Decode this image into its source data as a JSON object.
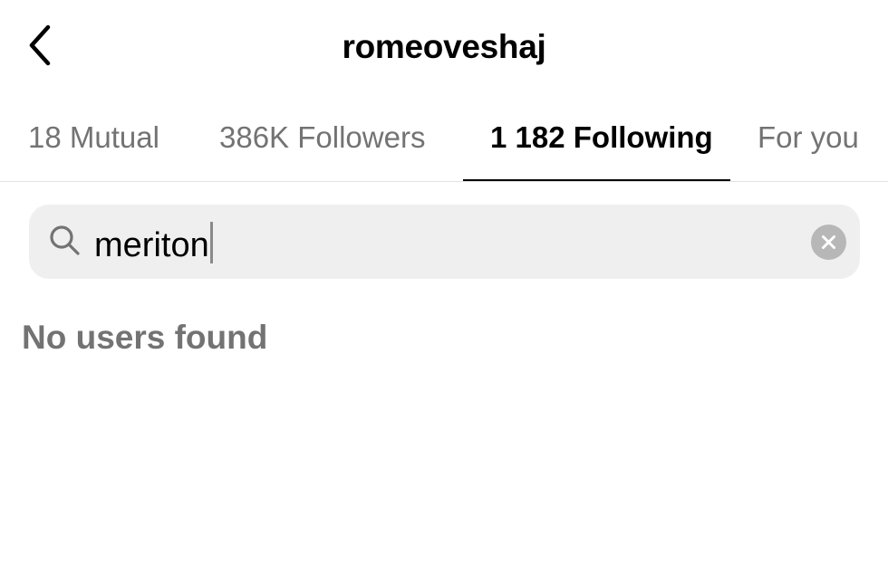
{
  "header": {
    "username": "romeoveshaj",
    "back_icon": "chevron-left-icon"
  },
  "tabs": [
    {
      "label": "18 Mutual",
      "active": false
    },
    {
      "label": "386K Followers",
      "active": false
    },
    {
      "label": "1 182 Following",
      "active": true
    },
    {
      "label": "For you",
      "active": false
    }
  ],
  "search": {
    "value": "meriton",
    "search_icon": "search-icon",
    "clear_icon": "clear-icon"
  },
  "results": {
    "empty_message": "No users found"
  },
  "colors": {
    "active_text": "#000000",
    "inactive_text": "#737373",
    "search_bg": "#efefef",
    "clear_bg": "#b7b7b7"
  }
}
